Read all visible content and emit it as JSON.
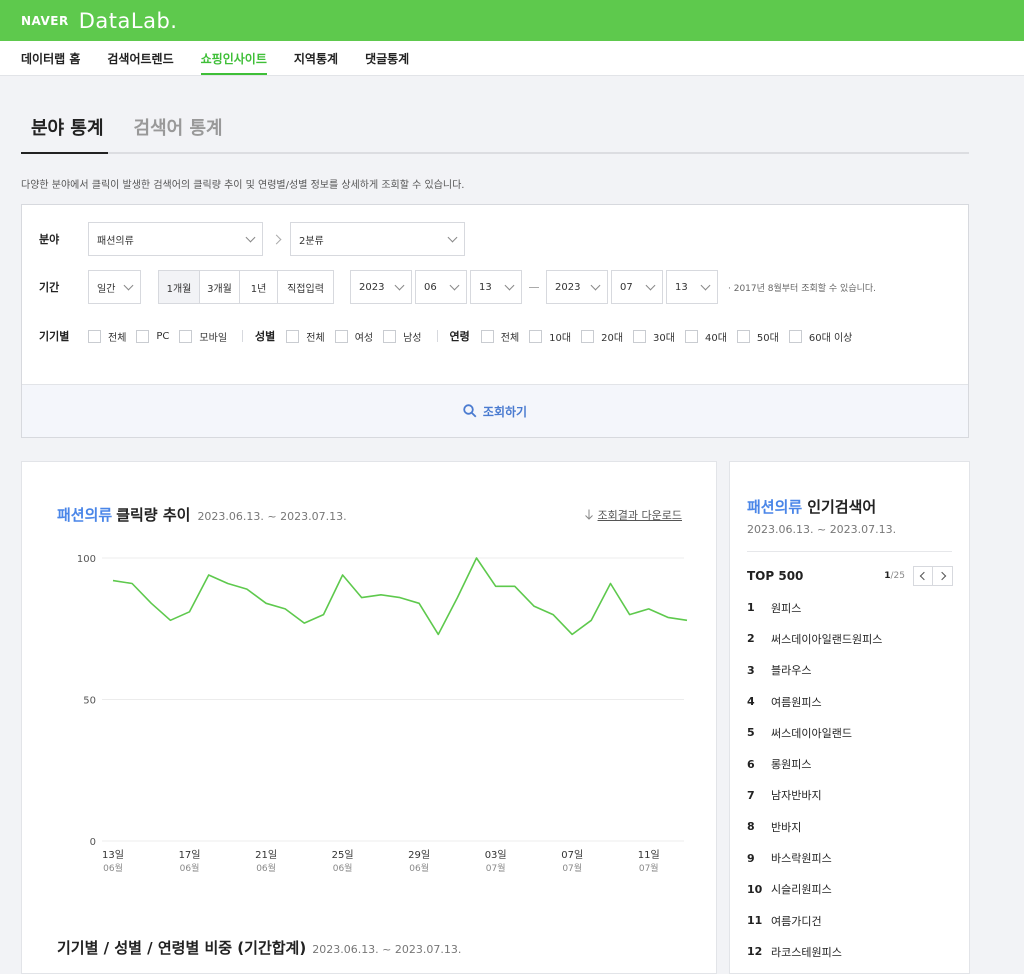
{
  "header": {
    "brand": "NAVER",
    "product": "DataLab."
  },
  "nav": [
    {
      "label": "데이터랩 홈",
      "active": false
    },
    {
      "label": "검색어트렌드",
      "active": false
    },
    {
      "label": "쇼핑인사이트",
      "active": true
    },
    {
      "label": "지역통계",
      "active": false
    },
    {
      "label": "댓글통계",
      "active": false
    }
  ],
  "tabs": [
    {
      "label": "분야 통계",
      "active": true
    },
    {
      "label": "검색어 통계",
      "active": false
    }
  ],
  "description": "다양한 분야에서 클릭이 발생한 검색어의 클릭량 추이 및 연령별/성별 정보를 상세하게 조회할 수 있습니다.",
  "filter": {
    "category_label": "분야",
    "category1": "패션의류",
    "category2": "2분류",
    "period_label": "기간",
    "period_unit": "일간",
    "ranges": [
      "1개월",
      "3개월",
      "1년",
      "직접입력"
    ],
    "start": {
      "year": "2023",
      "month": "06",
      "day": "13"
    },
    "end": {
      "year": "2023",
      "month": "07",
      "day": "13"
    },
    "period_note": "· 2017년 8월부터 조회할 수 있습니다.",
    "device_label": "기기별",
    "device_options": [
      "전체",
      "PC",
      "모바일"
    ],
    "gender_label": "성별",
    "gender_options": [
      "전체",
      "여성",
      "남성"
    ],
    "age_label": "연령",
    "age_options": [
      "전체",
      "10대",
      "20대",
      "30대",
      "40대",
      "50대",
      "60대 이상"
    ],
    "search_button": "조회하기"
  },
  "chart_panel": {
    "category": "패션의류",
    "title": "클릭량 추이",
    "date_range": "2023.06.13. ~ 2023.07.13.",
    "download": "조회결과 다운로드",
    "section2_title": "기기별 / 성별 / 연령별 비중 (기간합계)",
    "section2_date": "2023.06.13. ~ 2023.07.13."
  },
  "chart_data": {
    "type": "line",
    "x": [
      "2023-06-13",
      "2023-06-14",
      "2023-06-15",
      "2023-06-16",
      "2023-06-17",
      "2023-06-18",
      "2023-06-19",
      "2023-06-20",
      "2023-06-21",
      "2023-06-22",
      "2023-06-23",
      "2023-06-24",
      "2023-06-25",
      "2023-06-26",
      "2023-06-27",
      "2023-06-28",
      "2023-06-29",
      "2023-06-30",
      "2023-07-01",
      "2023-07-02",
      "2023-07-03",
      "2023-07-04",
      "2023-07-05",
      "2023-07-06",
      "2023-07-07",
      "2023-07-08",
      "2023-07-09",
      "2023-07-10",
      "2023-07-11",
      "2023-07-12",
      "2023-07-13"
    ],
    "series": [
      {
        "values": [
          92,
          91,
          84,
          78,
          81,
          94,
          91,
          89,
          84,
          82,
          77,
          80,
          94,
          86,
          87,
          86,
          84,
          73,
          86,
          100,
          90,
          90,
          83,
          80,
          73,
          78,
          91,
          80,
          82,
          79,
          78
        ]
      }
    ],
    "y_ticks": [
      "100",
      "50",
      "0"
    ],
    "ylim": [
      0,
      100
    ],
    "x_ticks": [
      {
        "day": "13일",
        "month": "06월",
        "index": 0
      },
      {
        "day": "17일",
        "month": "06월",
        "index": 4
      },
      {
        "day": "21일",
        "month": "06월",
        "index": 8
      },
      {
        "day": "25일",
        "month": "06월",
        "index": 12
      },
      {
        "day": "29일",
        "month": "06월",
        "index": 16
      },
      {
        "day": "03일",
        "month": "07월",
        "index": 20
      },
      {
        "day": "07일",
        "month": "07월",
        "index": 24
      },
      {
        "day": "11일",
        "month": "07월",
        "index": 28
      }
    ],
    "color": "#5ec94d",
    "grid": true
  },
  "rank_panel": {
    "category": "패션의류",
    "title": "인기검색어",
    "date_range": "2023.06.13. ~ 2023.07.13.",
    "top_label": "TOP 500",
    "page_current": "1",
    "page_total": "/25",
    "items": [
      {
        "rank": "1",
        "keyword": "원피스"
      },
      {
        "rank": "2",
        "keyword": "써스데이아일랜드원피스"
      },
      {
        "rank": "3",
        "keyword": "블라우스"
      },
      {
        "rank": "4",
        "keyword": "여름원피스"
      },
      {
        "rank": "5",
        "keyword": "써스데이아일랜드"
      },
      {
        "rank": "6",
        "keyword": "롱원피스"
      },
      {
        "rank": "7",
        "keyword": "남자반바지"
      },
      {
        "rank": "8",
        "keyword": "반바지"
      },
      {
        "rank": "9",
        "keyword": "바스락원피스"
      },
      {
        "rank": "10",
        "keyword": "시슬리원피스"
      },
      {
        "rank": "11",
        "keyword": "여름가디건"
      },
      {
        "rank": "12",
        "keyword": "라코스테원피스"
      }
    ]
  }
}
